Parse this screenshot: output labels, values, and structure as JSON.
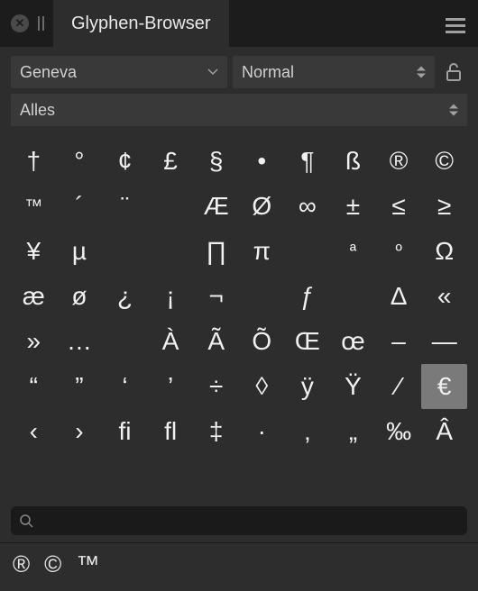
{
  "title": "Glyphen-Browser",
  "font": {
    "name": "Geneva",
    "style": "Normal"
  },
  "filter": "Alles",
  "search": {
    "placeholder": ""
  },
  "glyphs": [
    [
      "†",
      "°",
      "¢",
      "£",
      "§",
      "•",
      "¶",
      "ß",
      "®",
      "©"
    ],
    [
      "™",
      "´",
      "¨",
      "",
      "Æ",
      "Ø",
      "∞",
      "±",
      "≤",
      "≥"
    ],
    [
      "¥",
      "µ",
      "",
      "",
      "∏",
      "π",
      "",
      "ª",
      "º",
      "Ω"
    ],
    [
      "æ",
      "ø",
      "¿",
      "¡",
      "¬",
      "",
      "ƒ",
      "",
      "Δ",
      "«"
    ],
    [
      "»",
      "…",
      "",
      "À",
      "Ã",
      "Õ",
      "Œ",
      "œ",
      "–",
      "—"
    ],
    [
      "“",
      "”",
      "‘",
      "’",
      "÷",
      "◊",
      "ÿ",
      "Ÿ",
      "⁄",
      "€"
    ],
    [
      "‹",
      "›",
      "ﬁ",
      "ﬂ",
      "‡",
      "·",
      "‚",
      "„",
      "‰",
      "Â"
    ]
  ],
  "selected": {
    "row": 5,
    "col": 9
  },
  "recent": [
    "®",
    "©",
    "™"
  ]
}
